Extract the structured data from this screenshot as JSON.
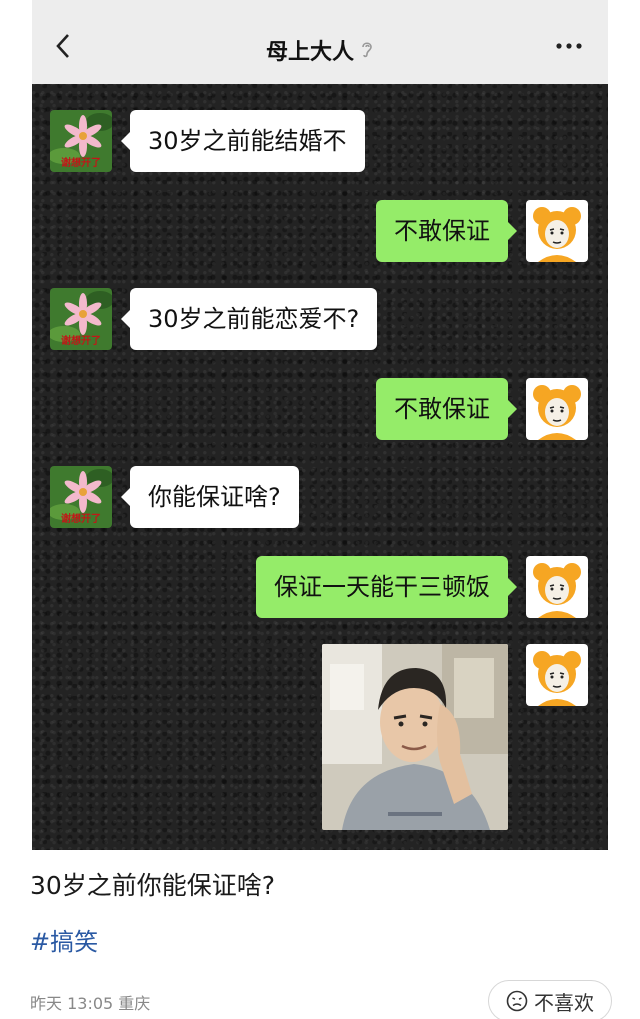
{
  "chat": {
    "title": "母上大人",
    "messages": [
      {
        "side": "left",
        "text": "30岁之前能结婚不"
      },
      {
        "side": "right",
        "text": "不敢保证"
      },
      {
        "side": "left",
        "text": "30岁之前能恋爱不?"
      },
      {
        "side": "right",
        "text": "不敢保证"
      },
      {
        "side": "left",
        "text": "你能保证啥?"
      },
      {
        "side": "right",
        "text": "保证一天能干三顿饭"
      }
    ],
    "mom_avatar_text": "谢想开了"
  },
  "post": {
    "caption": "30岁之前你能保证啥?",
    "hashtag": "#搞笑",
    "meta": "昨天 13:05 重庆",
    "dislike_label": "不喜欢"
  },
  "colors": {
    "bubble_right": "#95ec69",
    "bubble_left": "#ffffff",
    "hashtag": "#2a59a3"
  }
}
